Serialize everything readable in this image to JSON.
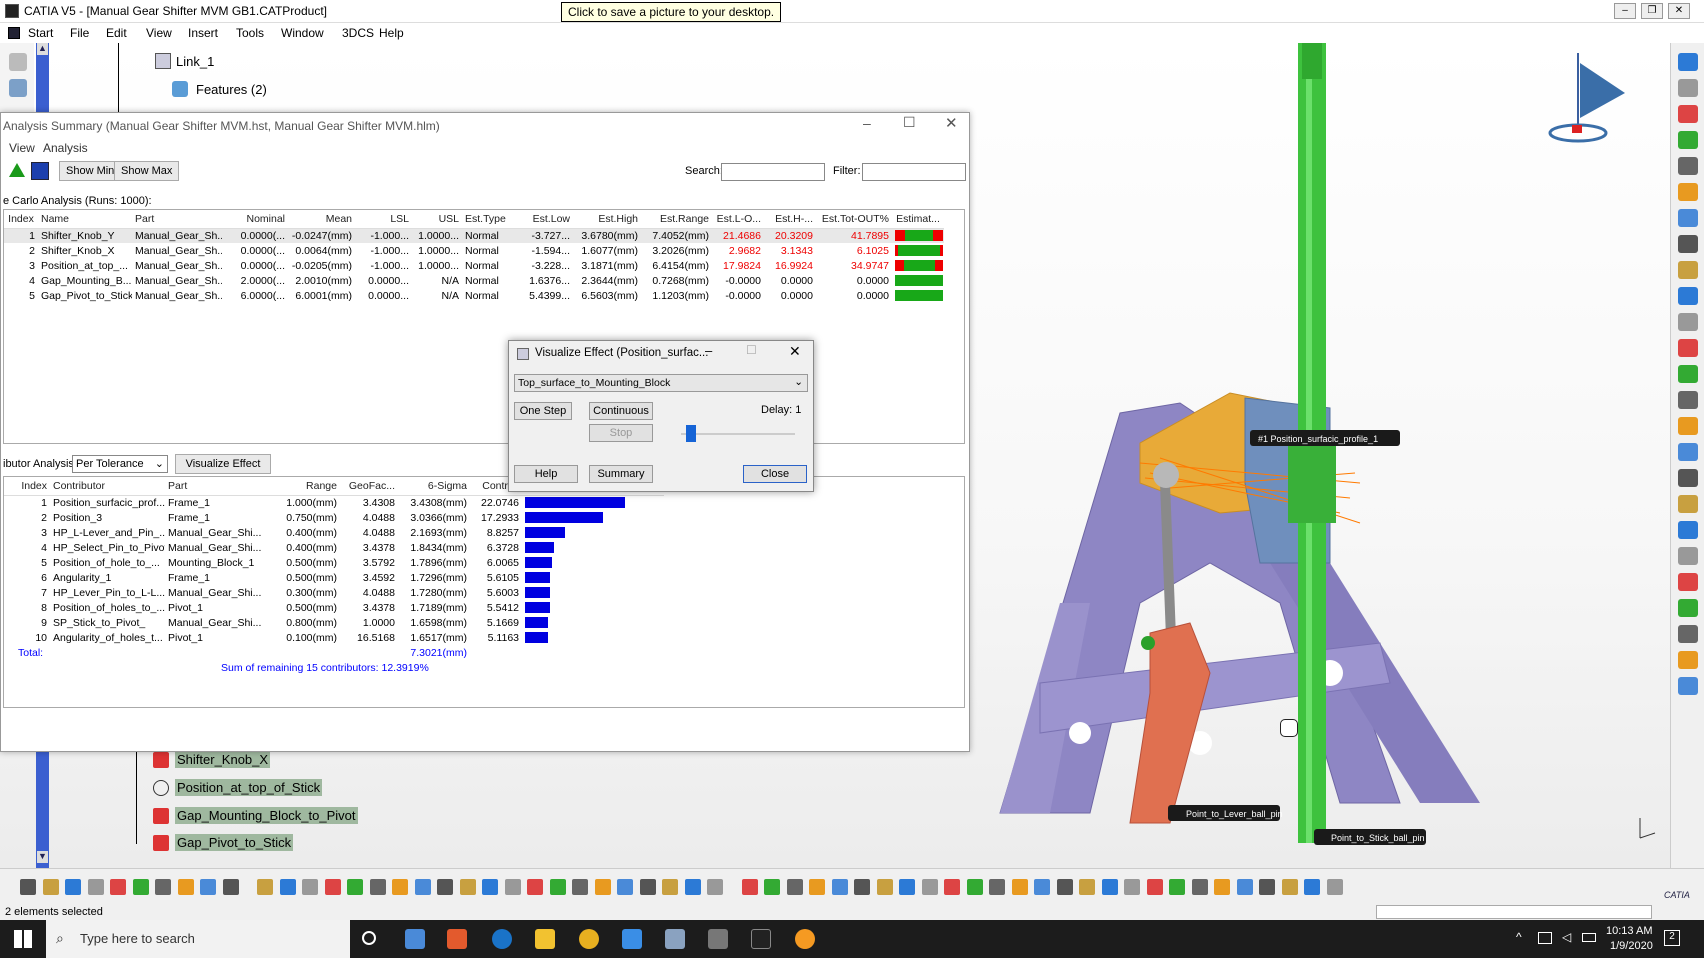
{
  "window": {
    "title": "CATIA V5 - [Manual Gear Shifter MVM GB1.CATProduct]",
    "tooltip": "Click to save a picture to your desktop."
  },
  "menu": [
    "Start",
    "File",
    "Edit",
    "View",
    "Insert",
    "Tools",
    "Window",
    "3DCS",
    "Help"
  ],
  "tree_top": {
    "link": "Link_1",
    "features": "Features (2)"
  },
  "tree_bottom": [
    "Shifter_Knob_X",
    "Position_at_top_of_Stick",
    "Gap_Mounting_Block_to_Pivot",
    "Gap_Pivot_to_Stick"
  ],
  "analysis": {
    "title": "Analysis Summary (Manual Gear Shifter MVM.hst, Manual Gear Shifter MVM.hlm)",
    "menu": [
      "View",
      "Analysis"
    ],
    "show_min": "Show Min",
    "show_max": "Show Max",
    "search_label": "Search:",
    "filter_label": "Filter:",
    "runs": "e Carlo Analysis (Runs: 1000):",
    "columns": [
      "Index",
      "Name",
      "Part",
      "Nominal",
      "Mean",
      "LSL",
      "USL",
      "Est.Type",
      "Est.Low",
      "Est.High",
      "Est.Range",
      "Est.L-O...",
      "Est.H-...",
      "Est.Tot-OUT%",
      "Estimat..."
    ],
    "rows": [
      [
        "1",
        "Shifter_Knob_Y",
        "Manual_Gear_Sh...",
        "0.0000(...",
        "-0.0247(mm)",
        "-1.000...",
        "1.0000...",
        "Normal",
        "-3.727...",
        "3.6780(mm)",
        "7.4052(mm)",
        "21.4686",
        "20.3209",
        "41.7895"
      ],
      [
        "2",
        "Shifter_Knob_X",
        "Manual_Gear_Sh...",
        "0.0000(...",
        "0.0064(mm)",
        "-1.000...",
        "1.0000...",
        "Normal",
        "-1.594...",
        "1.6077(mm)",
        "3.2026(mm)",
        "2.9682",
        "3.1343",
        "6.1025"
      ],
      [
        "3",
        "Position_at_top_...",
        "Manual_Gear_Sh...",
        "0.0000(...",
        "-0.0205(mm)",
        "-1.000...",
        "1.0000...",
        "Normal",
        "-3.228...",
        "3.1871(mm)",
        "6.4154(mm)",
        "17.9824",
        "16.9924",
        "34.9747"
      ],
      [
        "4",
        "Gap_Mounting_B...",
        "Manual_Gear_Sh...",
        "2.0000(...",
        "2.0010(mm)",
        "0.0000...",
        "N/A",
        "Normal",
        "1.6376...",
        "2.3644(mm)",
        "0.7268(mm)",
        "-0.0000",
        "0.0000",
        "0.0000"
      ],
      [
        "5",
        "Gap_Pivot_to_Stick",
        "Manual_Gear_Sh...",
        "6.0000(...",
        "6.0001(mm)",
        "0.0000...",
        "N/A",
        "Normal",
        "5.4399...",
        "6.5603(mm)",
        "1.1203(mm)",
        "-0.0000",
        "0.0000",
        "0.0000"
      ]
    ],
    "est_indicator": [
      {
        "low": 0.21,
        "high": 0.2
      },
      {
        "low": 0.03,
        "high": 0.03
      },
      {
        "low": 0.18,
        "high": 0.17
      },
      {
        "low": 0,
        "high": 0
      },
      {
        "low": 0,
        "high": 0
      }
    ],
    "contrib_label": "ibutor Analysis:",
    "contrib_select": "Per Tolerance",
    "visualize_effect": "Visualize Effect",
    "contrib_columns": [
      "Index",
      "Contributor",
      "Part",
      "Range",
      "GeoFac...",
      "6-Sigma",
      "Contri..."
    ],
    "contributors": [
      [
        "1",
        "Position_surfacic_prof...",
        "Frame_1",
        "1.000(mm)",
        "3.4308",
        "3.4308(mm)",
        "22.0746"
      ],
      [
        "2",
        "Position_3",
        "Frame_1",
        "0.750(mm)",
        "4.0488",
        "3.0366(mm)",
        "17.2933"
      ],
      [
        "3",
        "HP_L-Lever_and_Pin_...",
        "Manual_Gear_Shi...",
        "0.400(mm)",
        "4.0488",
        "2.1693(mm)",
        "8.8257"
      ],
      [
        "4",
        "HP_Select_Pin_to_Pivot",
        "Manual_Gear_Shi...",
        "0.400(mm)",
        "3.4378",
        "1.8434(mm)",
        "6.3728"
      ],
      [
        "5",
        "Position_of_hole_to_...",
        "Mounting_Block_1",
        "0.500(mm)",
        "3.5792",
        "1.7896(mm)",
        "6.0065"
      ],
      [
        "6",
        "Angularity_1",
        "Frame_1",
        "0.500(mm)",
        "3.4592",
        "1.7296(mm)",
        "5.6105"
      ],
      [
        "7",
        "HP_Lever_Pin_to_L-L...",
        "Manual_Gear_Shi...",
        "0.300(mm)",
        "4.0488",
        "1.7280(mm)",
        "5.6003"
      ],
      [
        "8",
        "Position_of_holes_to_...",
        "Pivot_1",
        "0.500(mm)",
        "3.4378",
        "1.7189(mm)",
        "5.5412"
      ],
      [
        "9",
        "SP_Stick_to_Pivot_",
        "Manual_Gear_Shi...",
        "0.800(mm)",
        "1.0000",
        "1.6598(mm)",
        "5.1669"
      ],
      [
        "10",
        "Angularity_of_holes_t...",
        "Pivot_1",
        "0.100(mm)",
        "16.5168",
        "1.6517(mm)",
        "5.1163"
      ]
    ],
    "total_label": "Total:",
    "total_value": "7.3021(mm)",
    "remaining": "Sum of remaining 15 contributors: 12.3919%"
  },
  "viz": {
    "title": "Visualize Effect (Position_surfac...",
    "select": "Top_surface_to_Mounting_Block",
    "one_step": "One Step",
    "continuous": "Continuous",
    "stop": "Stop",
    "delay": "Delay: 1",
    "slider_fraction": 0.05,
    "help": "Help",
    "summary": "Summary",
    "close": "Close"
  },
  "labels3d": {
    "profile": "#1   Position_surfacic_profile_1",
    "lever_pin": "Point_to_Lever_ball_pin",
    "stick_pin": "Point_to_Stick_ball_pin"
  },
  "status": "2 elements selected",
  "taskbar": {
    "search": "Type here to search",
    "time": "10:13 AM",
    "date": "1/9/2020",
    "badge": "2"
  },
  "catia_logo": "CATIA"
}
